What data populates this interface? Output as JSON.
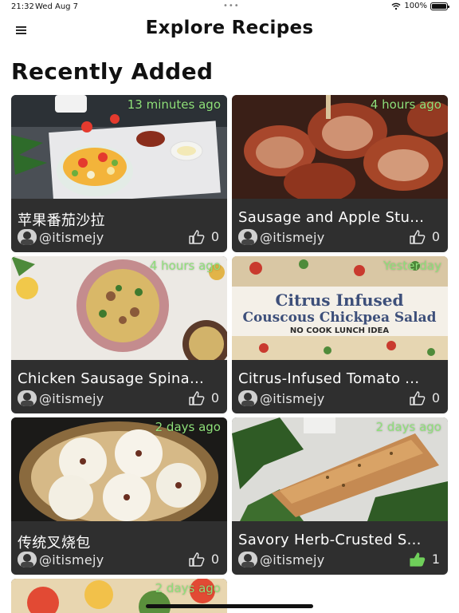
{
  "status_bar": {
    "time": "21:32",
    "date": "Wed Aug 7",
    "battery": "100%",
    "battery_level": 1.0
  },
  "nav": {
    "title": "Explore Recipes",
    "menu_icon": "hamburger-menu-icon"
  },
  "section": {
    "title": "Recently Added"
  },
  "cards": [
    {
      "title": "苹果番茄沙拉",
      "time": "13 minutes ago",
      "user": "@itismejy",
      "likes": "0",
      "liked": false
    },
    {
      "title": "Sausage and Apple Stu...",
      "time": "4 hours ago",
      "user": "@itismejy",
      "likes": "0",
      "liked": false
    },
    {
      "title": "Chicken Sausage Spina...",
      "time": "4 hours ago",
      "user": "@itismejy",
      "likes": "0",
      "liked": false
    },
    {
      "title": "Citrus-Infused Tomato ...",
      "time": "Yesterday",
      "user": "@itismejy",
      "likes": "0",
      "liked": false,
      "image_text": {
        "line1": "Citrus Infused",
        "line2": "Couscous Chickpea Salad",
        "line3": "NO COOK LUNCH IDEA"
      }
    },
    {
      "title": "传统叉烧包",
      "time": "2 days ago",
      "user": "@itismejy",
      "likes": "0",
      "liked": false
    },
    {
      "title": "Savory Herb-Crusted S...",
      "time": "2 days ago",
      "user": "@itismejy",
      "likes": "1",
      "liked": true
    },
    {
      "time": "2 days ago"
    }
  ],
  "colors": {
    "accent_green": "#8fe07a",
    "card_bg": "#2f2f2f",
    "liked": "#6fcf5a"
  }
}
